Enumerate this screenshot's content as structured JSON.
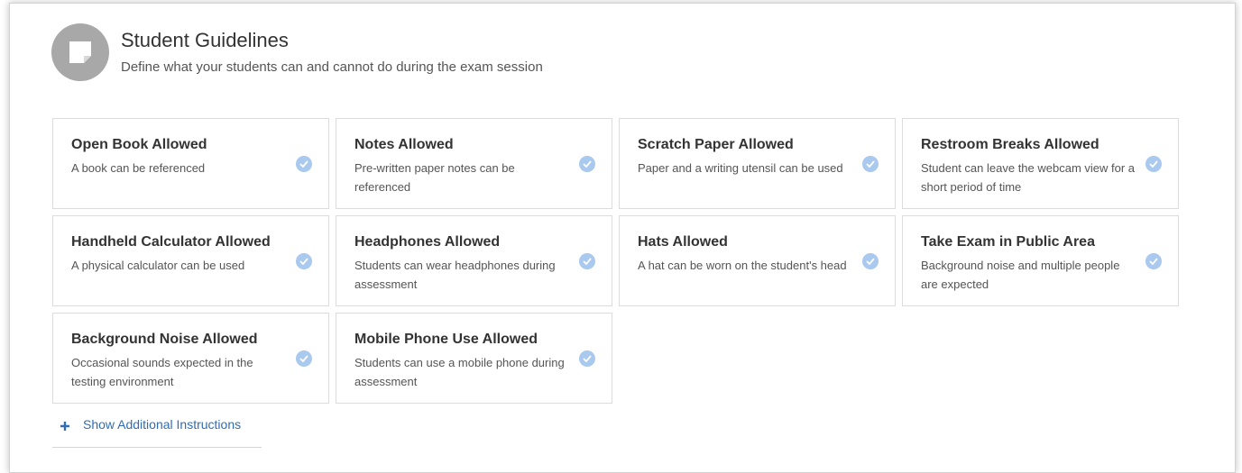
{
  "header": {
    "title": "Student Guidelines",
    "subtitle": "Define what your students can and cannot do during the exam session",
    "icon": "sticky-note-icon"
  },
  "colors": {
    "accent": "#2f6db5",
    "check": "#a9c9ee",
    "icon_bg": "#a8a8a8"
  },
  "guidelines": [
    {
      "title": "Open Book Allowed",
      "description": "A book can be referenced"
    },
    {
      "title": "Notes Allowed",
      "description": "Pre-written paper notes can be referenced"
    },
    {
      "title": "Scratch Paper Allowed",
      "description": "Paper and a writing utensil can be used"
    },
    {
      "title": "Restroom Breaks Allowed",
      "description": "Student can leave the webcam view for a short period of time"
    },
    {
      "title": "Handheld Calculator Allowed",
      "description": "A physical calculator can be used"
    },
    {
      "title": "Headphones Allowed",
      "description": "Students can wear headphones during assessment"
    },
    {
      "title": "Hats Allowed",
      "description": "A hat can be worn on the student's head"
    },
    {
      "title": "Take Exam in Public Area",
      "description": "Background noise and multiple people are expected"
    },
    {
      "title": "Background Noise Allowed",
      "description": "Occasional sounds expected in the testing environment"
    },
    {
      "title": "Mobile Phone Use Allowed",
      "description": "Students can use a mobile phone during assessment"
    }
  ],
  "additional": {
    "label": "Show Additional Instructions",
    "icon": "plus-icon"
  }
}
